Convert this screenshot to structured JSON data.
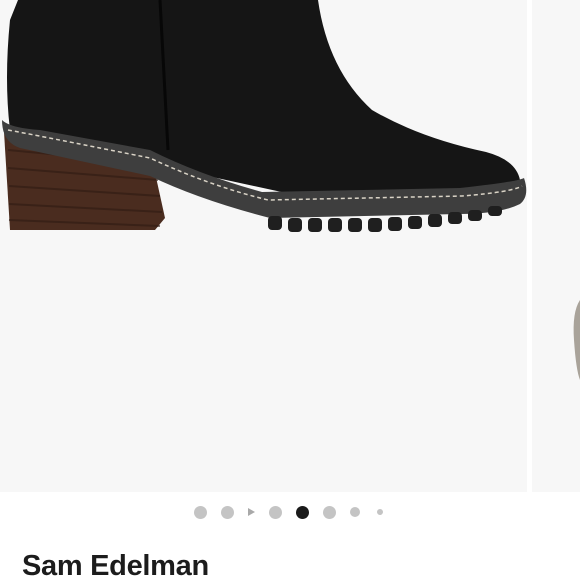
{
  "product": {
    "brand": "Sam Edelman",
    "image_icon": "black-suede-ankle-boot"
  },
  "carousel": {
    "total_slides": 8,
    "active_index": 4,
    "has_video": true
  }
}
